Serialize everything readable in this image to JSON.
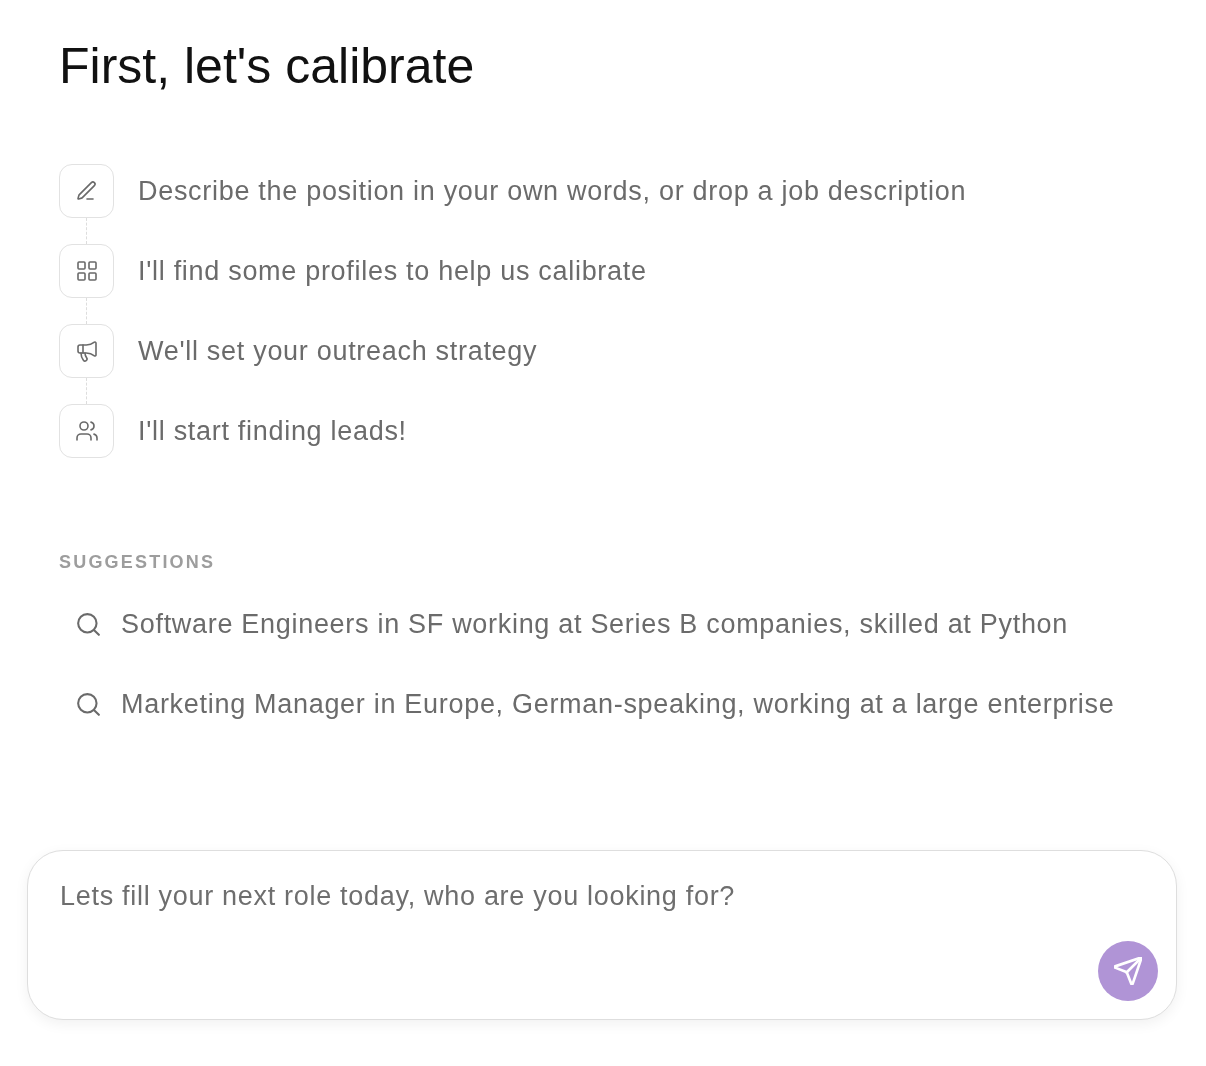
{
  "title": "First, let's calibrate",
  "steps": [
    {
      "text": "Describe the position in your own words, or drop a job description"
    },
    {
      "text": "I'll find some profiles to help us calibrate"
    },
    {
      "text": "We'll set your outreach strategy"
    },
    {
      "text": "I'll start finding leads!"
    }
  ],
  "suggestions": {
    "heading": "SUGGESTIONS",
    "items": [
      "Software Engineers in SF working at Series B companies, skilled at Python",
      "Marketing Manager in Europe, German-speaking, working at a large enterprise"
    ]
  },
  "composer": {
    "placeholder": "Lets fill your next role today, who are you looking for?"
  }
}
